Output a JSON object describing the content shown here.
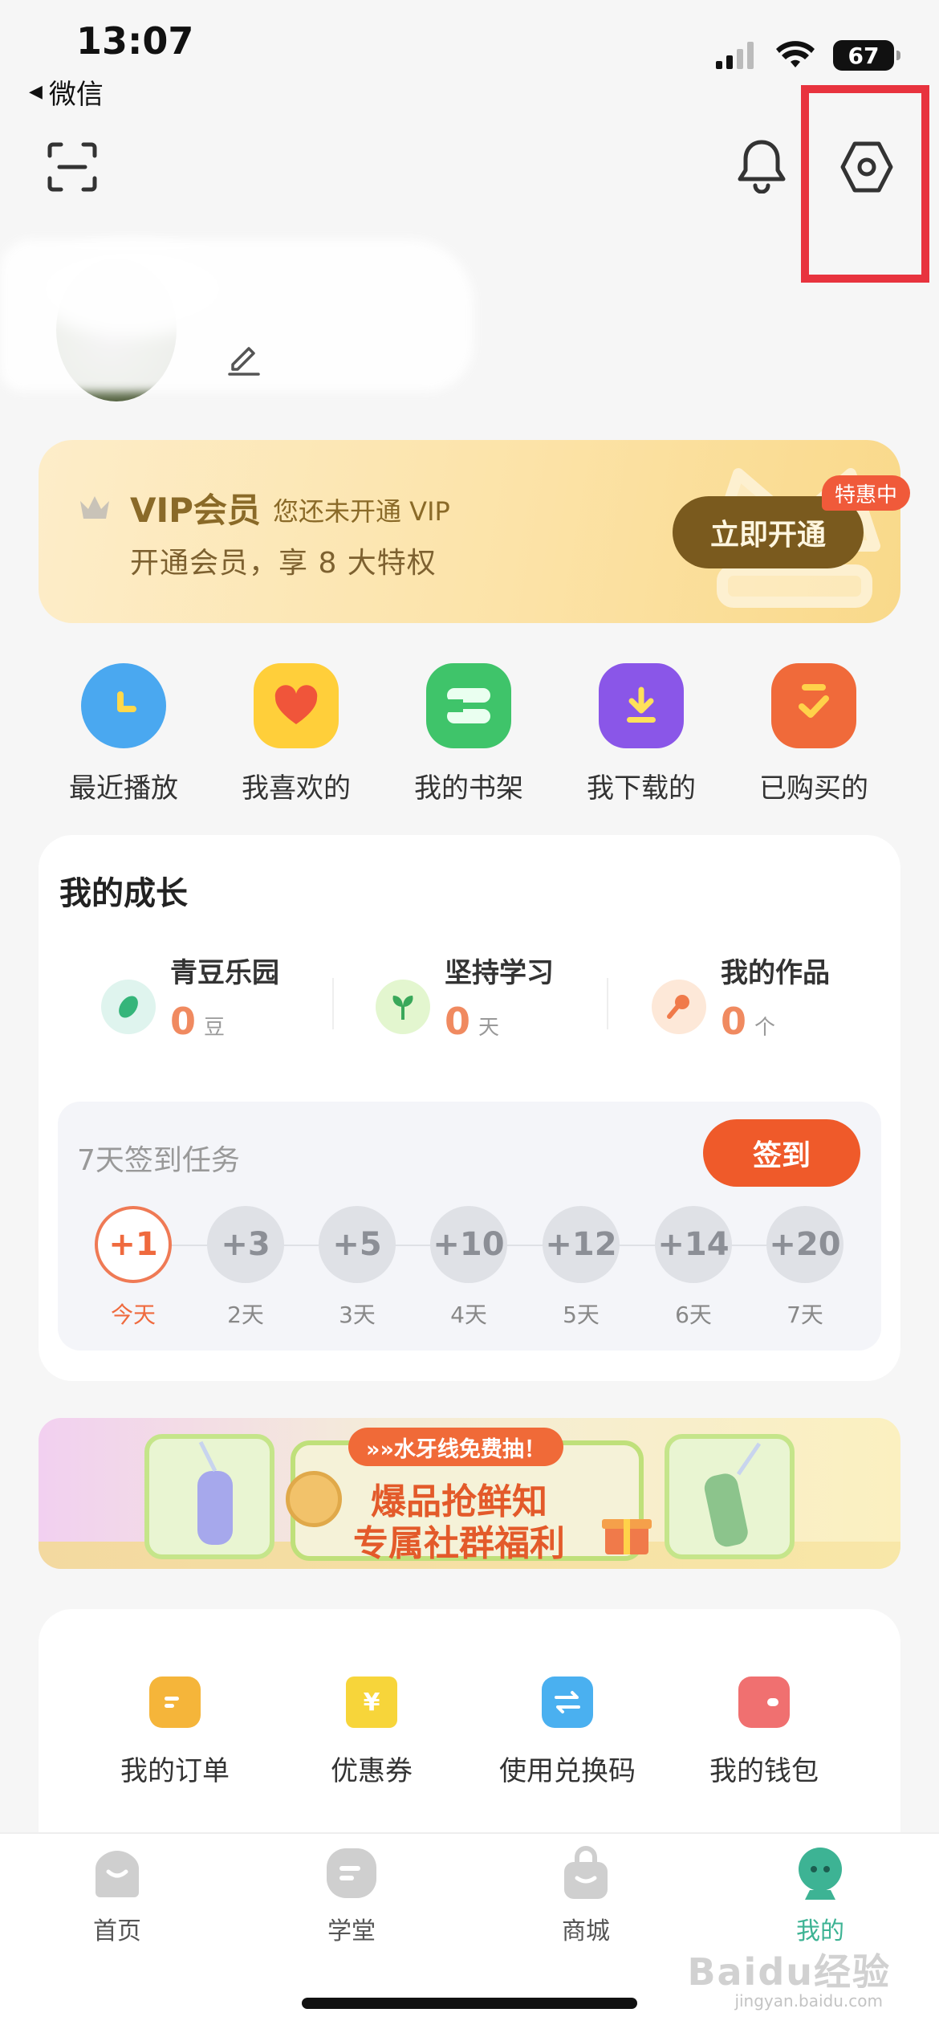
{
  "status_bar": {
    "time": "13:07",
    "back_app": "微信",
    "battery": "67"
  },
  "vip": {
    "title": "VIP会员",
    "status": "您还未开通 VIP",
    "desc": "开通会员，享 8 大特权",
    "button": "立即开通",
    "tag": "特惠中",
    "colors": {
      "button_bg": "#7a5a1e",
      "tag_bg": "#f05a3a"
    }
  },
  "quick_actions": [
    {
      "label": "最近播放",
      "icon": "clock-icon"
    },
    {
      "label": "我喜欢的",
      "icon": "heart-icon"
    },
    {
      "label": "我的书架",
      "icon": "bookshelf-icon"
    },
    {
      "label": "我下载的",
      "icon": "download-icon"
    },
    {
      "label": "已购买的",
      "icon": "purchased-icon"
    }
  ],
  "growth": {
    "title": "我的成长",
    "stats": [
      {
        "label": "青豆乐园",
        "value": "0",
        "unit": "豆",
        "icon": "bean-icon"
      },
      {
        "label": "坚持学习",
        "value": "0",
        "unit": "天",
        "icon": "sprout-icon"
      },
      {
        "label": "我的作品",
        "value": "0",
        "unit": "个",
        "icon": "microphone-icon"
      }
    ],
    "task": {
      "title": "7天签到任务",
      "button": "签到",
      "days": [
        {
          "points": "+1",
          "label": "今天"
        },
        {
          "points": "+3",
          "label": "2天"
        },
        {
          "points": "+5",
          "label": "3天"
        },
        {
          "points": "+10",
          "label": "4天"
        },
        {
          "points": "+12",
          "label": "5天"
        },
        {
          "points": "+14",
          "label": "6天"
        },
        {
          "points": "+20",
          "label": "7天"
        }
      ]
    }
  },
  "banner": {
    "tag": "»»水牙线免费抽！",
    "line1": "爆品抢鲜知",
    "line2": "专属社群福利"
  },
  "services": [
    {
      "label": "我的订单",
      "icon": "order-icon"
    },
    {
      "label": "优惠券",
      "icon": "coupon-icon"
    },
    {
      "label": "使用兑换码",
      "icon": "exchange-icon"
    },
    {
      "label": "我的钱包",
      "icon": "wallet-icon"
    }
  ],
  "tabs": [
    {
      "label": "首页",
      "icon": "home-icon"
    },
    {
      "label": "学堂",
      "icon": "school-icon"
    },
    {
      "label": "商城",
      "icon": "shop-bag-icon"
    },
    {
      "label": "我的",
      "icon": "profile-icon",
      "active": true
    }
  ],
  "watermark": {
    "brand": "Baidu经验",
    "url": "jingyan.baidu.com"
  },
  "colors": {
    "accent_orange": "#ef5a2a",
    "accent_green": "#3db394",
    "highlight": "#e8333e"
  }
}
